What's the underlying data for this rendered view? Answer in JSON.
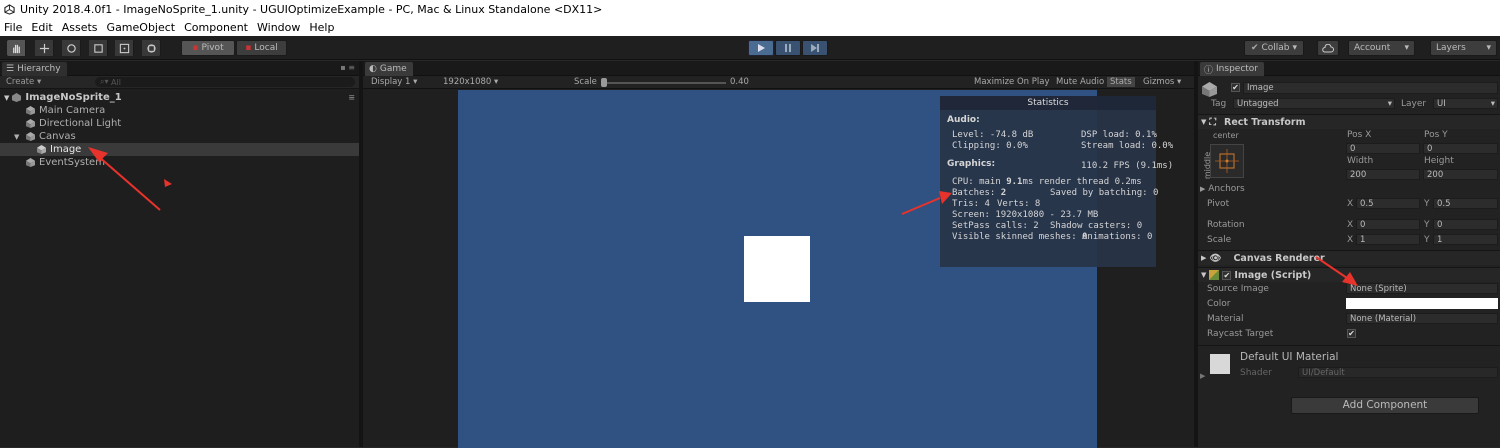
{
  "window": {
    "title": "Unity 2018.4.0f1 - ImageNoSprite_1.unity - UGUIOptimizeExample - PC, Mac & Linux Standalone <DX11>"
  },
  "menu": [
    "File",
    "Edit",
    "Assets",
    "GameObject",
    "Component",
    "Window",
    "Help"
  ],
  "toolbar": {
    "pivot_label": "Pivot",
    "local_label": "Local",
    "collab_label": "Collab",
    "account_label": "Account",
    "layers_label": "Layers"
  },
  "hierarchy": {
    "tab_label": "Hierarchy",
    "create_label": "Create",
    "search_placeholder": "All",
    "scene_name": "ImageNoSprite_1",
    "items": [
      "Main Camera",
      "Directional Light",
      "Canvas",
      "Image",
      "EventSystem"
    ]
  },
  "game": {
    "tab_label": "Game",
    "display": "Display 1",
    "resolution": "1920x1080",
    "scale_label": "Scale",
    "scale_value": "0.40",
    "maximize_on_play": "Maximize On Play",
    "mute_audio": "Mute Audio",
    "stats": "Stats",
    "gizmos": "Gizmos",
    "square_color": "#ffffff",
    "background_color": "#2f5282"
  },
  "statistics": {
    "title": "Statistics",
    "audio_heading": "Audio:",
    "level": "Level: -74.8 dB",
    "clipping": "Clipping: 0.0%",
    "dsp": "DSP load: 0.1%",
    "stream": "Stream load: 0.0%",
    "graphics_heading": "Graphics:",
    "fps": "110.2 FPS (9.1ms)",
    "cpu_prefix": "CPU: main ",
    "cpu_main": "9.1",
    "cpu_suffix": "ms  render thread 0.2ms",
    "batches_prefix": "Batches: ",
    "batches": "2",
    "saved_batching": "Saved by batching: 0",
    "tris": "Tris: 4",
    "verts": "Verts: 8",
    "screen": "Screen: 1920x1080 - 23.7 MB",
    "setpass": "SetPass calls: 2",
    "shadow_casters": "Shadow casters: 0",
    "skinned": "Visible skinned meshes: 0",
    "animations": "Animations: 0"
  },
  "inspector": {
    "tab_label": "Inspector",
    "object_name": "Image",
    "tag_label": "Tag",
    "tag_value": "Untagged",
    "layer_label": "Layer",
    "layer_value": "UI",
    "rect_transform": {
      "title": "Rect Transform",
      "anchor_h": "center",
      "anchor_v": "middle",
      "pos_x_label": "Pos X",
      "pos_y_label": "Pos Y",
      "pos_x": "0",
      "pos_y": "0",
      "width_label": "Width",
      "height_label": "Height",
      "width": "200",
      "height": "200",
      "anchors_label": "Anchors",
      "pivot_label": "Pivot",
      "pivot_x": "0.5",
      "pivot_y": "0.5",
      "rotation_label": "Rotation",
      "rot_x": "0",
      "rot_y": "0",
      "scale_label": "Scale",
      "scale_x": "1",
      "scale_y": "1",
      "x": "X",
      "y": "Y"
    },
    "canvas_renderer": {
      "title": "Canvas Renderer"
    },
    "image_script": {
      "title": "Image (Script)",
      "source_image_label": "Source Image",
      "source_image_value": "None (Sprite)",
      "color_label": "Color",
      "color_value": "#ffffff",
      "material_label": "Material",
      "material_value": "None (Material)",
      "raycast_label": "Raycast Target"
    },
    "material": {
      "name": "Default UI Material",
      "shader_label": "Shader",
      "shader_value": "UI/Default"
    },
    "add_component": "Add Component"
  },
  "annotation_color": "#e8322c"
}
